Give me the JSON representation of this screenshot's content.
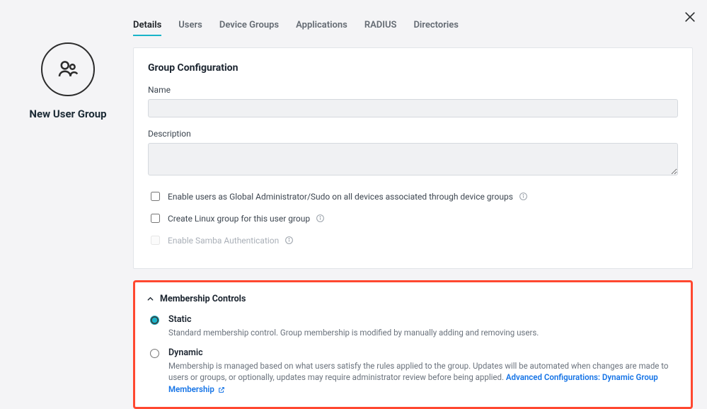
{
  "title": "New User Group",
  "tabs": [
    "Details",
    "Users",
    "Device Groups",
    "Applications",
    "RADIUS",
    "Directories"
  ],
  "activeTab": 0,
  "panel": {
    "heading": "Group Configuration",
    "nameLabel": "Name",
    "nameValue": "",
    "descLabel": "Description",
    "descValue": "",
    "check1": "Enable users as Global Administrator/Sudo on all devices associated through device groups",
    "check2": "Create Linux group for this user group",
    "check3": "Enable Samba Authentication"
  },
  "membership": {
    "heading": "Membership Controls",
    "static": {
      "title": "Static",
      "desc": "Standard membership control. Group membership is modified by manually adding and removing users."
    },
    "dynamic": {
      "title": "Dynamic",
      "desc": "Membership is managed based on what users satisfy the rules applied to the group. Updates will be automated when changes are made to users or groups, or optionally, updates may require administrator review before being applied. ",
      "link": "Advanced Configurations: Dynamic Group Membership"
    }
  }
}
